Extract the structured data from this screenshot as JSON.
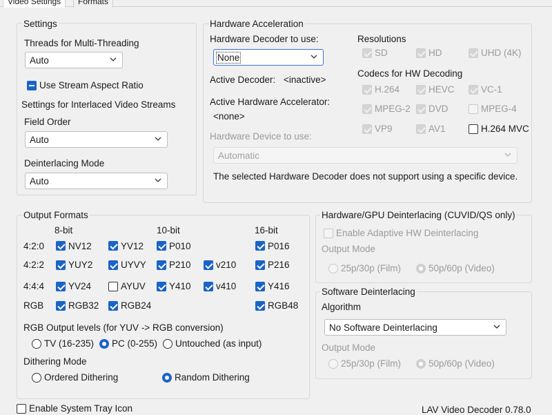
{
  "tabs": {
    "video_settings": "Video Settings",
    "formats": "Formats"
  },
  "settings": {
    "title": "Settings",
    "threads_label": "Threads for Multi-Threading",
    "threads_value": "Auto",
    "stream_aspect_label": "Use Stream Aspect Ratio",
    "interlaced_label": "Settings for Interlaced Video Streams",
    "field_order_label": "Field Order",
    "field_order_value": "Auto",
    "deinterlacing_label": "Deinterlacing Mode",
    "deinterlacing_value": "Auto"
  },
  "hwaccel": {
    "title": "Hardware Acceleration",
    "decoder_label": "Hardware Decoder to use:",
    "decoder_value": "None",
    "active_decoder_label": "Active Decoder:",
    "active_decoder_value": "<inactive>",
    "active_accel_label": "Active Hardware Accelerator:",
    "active_accel_value": "<none>",
    "device_label": "Hardware Device to use:",
    "device_value": "Automatic",
    "device_note": "The selected Hardware Decoder does not support using a specific device.",
    "resolutions_label": "Resolutions",
    "res": {
      "sd": "SD",
      "hd": "HD",
      "uhd": "UHD (4K)"
    },
    "codecs_label": "Codecs for HW Decoding",
    "codecs": {
      "h264": "H.264",
      "hevc": "HEVC",
      "vc1": "VC-1",
      "mpeg2": "MPEG-2",
      "dvd": "DVD",
      "mpeg4": "MPEG-4",
      "vp9": "VP9",
      "av1": "AV1",
      "h264mvc": "H.264 MVC"
    }
  },
  "output": {
    "title": "Output Formats",
    "col_8bit": "8-bit",
    "col_10bit": "10-bit",
    "col_16bit": "16-bit",
    "row_420": "4:2:0",
    "row_422": "4:2:2",
    "row_444": "4:4:4",
    "row_rgb": "RGB",
    "fmt": {
      "nv12": "NV12",
      "yv12": "YV12",
      "p010": "P010",
      "p016": "P016",
      "yuy2": "YUY2",
      "uyvy": "UYVY",
      "p210": "P210",
      "v210": "v210",
      "p216": "P216",
      "yv24": "YV24",
      "ayuv": "AYUV",
      "y410": "Y410",
      "v410": "v410",
      "y416": "Y416",
      "rgb32": "RGB32",
      "rgb24": "RGB24",
      "rgb48": "RGB48"
    },
    "rgb_levels_label": "RGB Output levels (for YUV -> RGB conversion)",
    "rgb_tv": "TV (16-235)",
    "rgb_pc": "PC (0-255)",
    "rgb_untouched": "Untouched (as input)",
    "dither_label": "Dithering Mode",
    "dither_ordered": "Ordered Dithering",
    "dither_random": "Random Dithering"
  },
  "hwdeint": {
    "title": "Hardware/GPU Deinterlacing (CUVID/QS only)",
    "adaptive_label": "Enable Adaptive HW Deinterlacing",
    "output_mode_label": "Output Mode",
    "film": "25p/30p (Film)",
    "video": "50p/60p (Video)"
  },
  "swdeint": {
    "title": "Software Deinterlacing",
    "algorithm_label": "Algorithm",
    "algorithm_value": "No Software Deinterlacing",
    "output_mode_label": "Output Mode",
    "film": "25p/30p (Film)",
    "video": "50p/60p (Video)"
  },
  "footer": {
    "tray_label": "Enable System Tray Icon",
    "version": "LAV Video Decoder 0.78.0"
  }
}
